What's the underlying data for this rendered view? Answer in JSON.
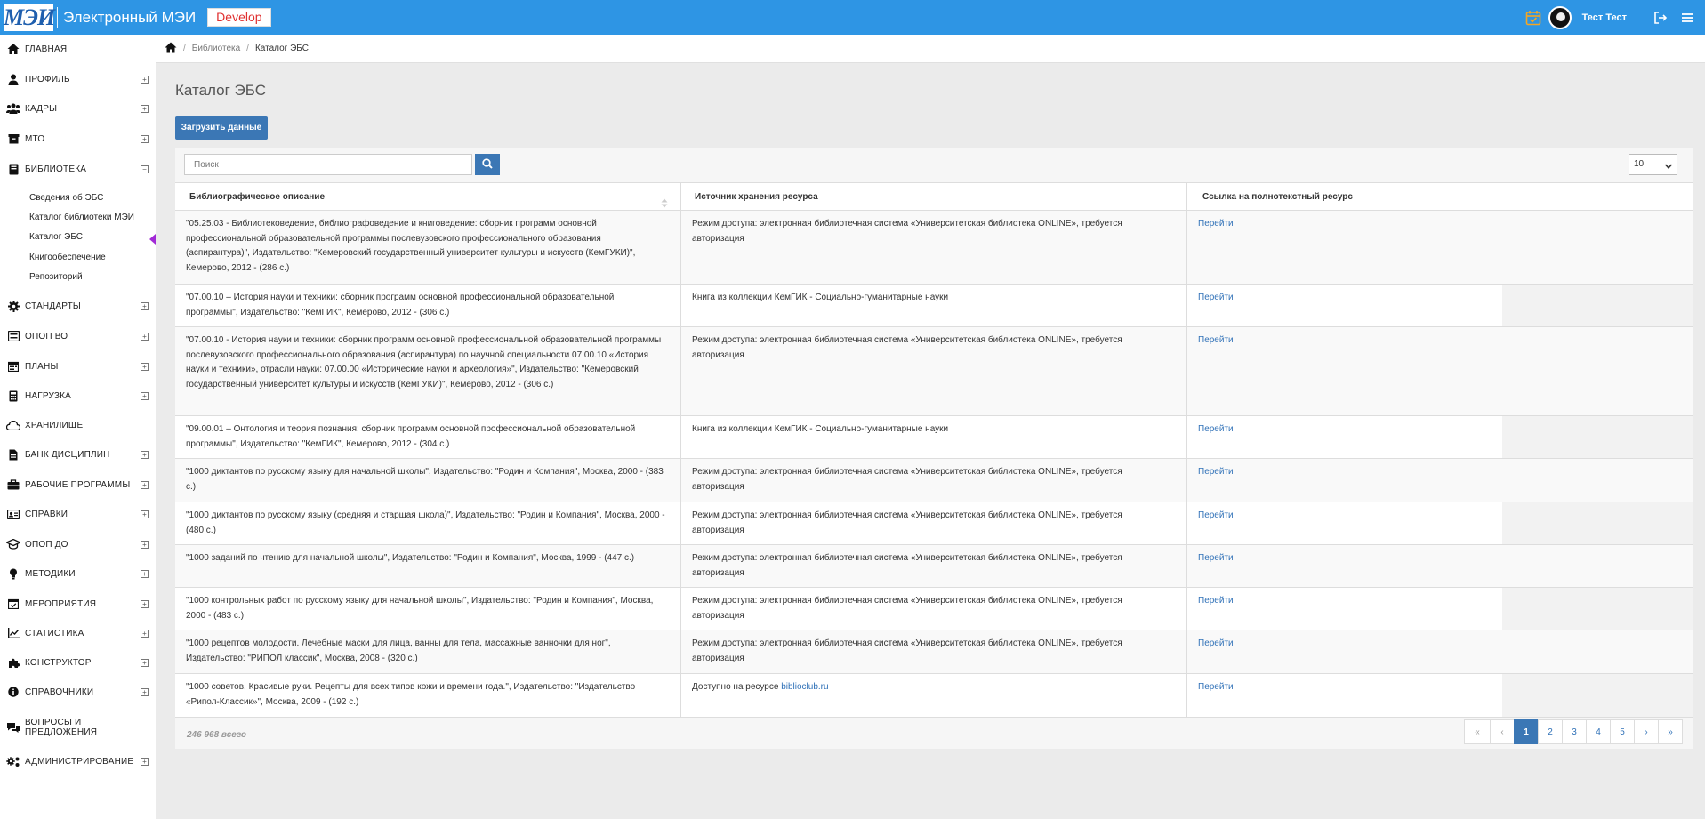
{
  "header": {
    "logo_text": "МЭИ",
    "app_title": "Электронный МЭИ",
    "env_badge": "Develop",
    "user_name": "Тест Тест",
    "icons": [
      "calendar-check-icon",
      "avatar",
      "logout-icon",
      "menu-icon"
    ]
  },
  "sidebar": {
    "items": [
      {
        "label": "ГЛАВНАЯ",
        "icon": "home-icon",
        "toggle": ""
      },
      {
        "label": "ПРОФИЛЬ",
        "icon": "user-icon",
        "toggle": "+"
      },
      {
        "label": "КАДРЫ",
        "icon": "users-icon",
        "toggle": "+"
      },
      {
        "label": "МТО",
        "icon": "box-icon",
        "toggle": "+"
      },
      {
        "label": "БИБЛИОТЕКА",
        "icon": "book-icon",
        "toggle": "−"
      },
      {
        "label": "СТАНДАРТЫ",
        "icon": "cog-icon",
        "toggle": "+"
      },
      {
        "label": "ОПОП ВО",
        "icon": "list-icon",
        "toggle": "+"
      },
      {
        "label": "ПЛАНЫ",
        "icon": "calendar-icon",
        "toggle": "+"
      },
      {
        "label": "НАГРУЗКА",
        "icon": "calculator-icon",
        "toggle": "+"
      },
      {
        "label": "ХРАНИЛИЩЕ",
        "icon": "cloud-icon",
        "toggle": ""
      },
      {
        "label": "БАНК ДИСЦИПЛИН",
        "icon": "file-icon",
        "toggle": "+"
      },
      {
        "label": "РАБОЧИЕ ПРОГРАММЫ",
        "icon": "briefcase-icon",
        "toggle": "+"
      },
      {
        "label": "СПРАВКИ",
        "icon": "id-card-icon",
        "toggle": "+"
      },
      {
        "label": "ОПОП ДО",
        "icon": "graduation-cap-icon",
        "toggle": "+"
      },
      {
        "label": "МЕТОДИКИ",
        "icon": "lightbulb-icon",
        "toggle": "+"
      },
      {
        "label": "МЕРОПРИЯТИЯ",
        "icon": "calendar-check-icon",
        "toggle": "+"
      },
      {
        "label": "СТАТИСТИКА",
        "icon": "chart-icon",
        "toggle": "+"
      },
      {
        "label": "КОНСТРУКТОР",
        "icon": "puzzle-icon",
        "toggle": "+"
      },
      {
        "label": "СПРАВОЧНИКИ",
        "icon": "info-icon",
        "toggle": "+"
      },
      {
        "label": "ВОПРОСЫ И ПРЕДЛОЖЕНИЯ",
        "icon": "comments-icon",
        "toggle": ""
      },
      {
        "label": "АДМИНИСТРИРОВАНИЕ",
        "icon": "cogs-icon",
        "toggle": "+"
      }
    ],
    "library_sub": [
      "Сведения об ЭБС",
      "Каталог библиотеки МЭИ",
      "Каталог ЭБС",
      "Книгообеспечение",
      "Репозиторий"
    ]
  },
  "breadcrumb": {
    "items": [
      "Библиотека",
      "Каталог ЭБС"
    ]
  },
  "main": {
    "title": "Каталог ЭБС",
    "load_button": "Загрузить данные",
    "search_placeholder": "Поиск",
    "page_size": "10",
    "columns": [
      "Библиографическое описание",
      "Источник хранения ресурса",
      "Ссылка на полнотекстный ресурс"
    ],
    "rows": [
      {
        "desc": "\"05.25.03 - Библиотековедение, библиографоведение и книговедение: сборник программ основной профессиональной образовательной программы послевузовского профессионального образования (аспирантура)\", Издательство: \"Кемеровский государственный университет культуры и искусств (КемГУКИ)\", Кемерово, 2012 - (286 с.)",
        "source": "Режим доступа: электронная библиотечная система «Университетская библиотека ONLINE», требуется авторизация",
        "source_link": "",
        "link": "Перейти"
      },
      {
        "desc": "\"07.00.10 – История науки и техники: сборник программ основной профессиональной образовательной программы\", Издательство: \"КемГИК\", Кемерово, 2012 - (306 с.)",
        "source": "Книга из коллекции КемГИК - Социально-гуманитарные науки",
        "source_link": "",
        "link": "Перейти"
      },
      {
        "desc": "\"07.00.10 - История науки и техники: сборник программ основной профессиональной образовательной программы послевузовского профессионального образования (аспирантура) по научной специальности 07.00.10 «История науки и техники», отрасли науки: 07.00.00 «Исторические науки и археология»\", Издательство: \"Кемеровский государственный университет культуры и искусств (КемГУКИ)\", Кемерово, 2012 - (306 с.)",
        "source": "Режим доступа: электронная библиотечная система «Университетская библиотека ONLINE», требуется авторизация",
        "source_link": "",
        "link": "Перейти"
      },
      {
        "desc": "\"09.00.01 – Онтология и теория познания: сборник программ основной профессиональной образовательной программы\", Издательство: \"КемГИК\", Кемерово, 2012 - (304 с.)",
        "source": "Книга из коллекции КемГИК - Социально-гуманитарные науки",
        "source_link": "",
        "link": "Перейти"
      },
      {
        "desc": "\"1000 диктантов по русскому языку для начальной школы\", Издательство: \"Родин и Компания\", Москва, 2000 - (383 с.)",
        "source": "Режим доступа: электронная библиотечная система «Университетская библиотека ONLINE», требуется авторизация",
        "source_link": "",
        "link": "Перейти"
      },
      {
        "desc": "\"1000 диктантов по русскому языку (средняя и старшая школа)\", Издательство: \"Родин и Компания\", Москва, 2000 - (480 с.)",
        "source": "Режим доступа: электронная библиотечная система «Университетская библиотека ONLINE», требуется авторизация",
        "source_link": "",
        "link": "Перейти"
      },
      {
        "desc": "\"1000 заданий по чтению для начальной школы\", Издательство: \"Родин и Компания\", Москва, 1999 - (447 с.)",
        "source": "Режим доступа: электронная библиотечная система «Университетская библиотека ONLINE», требуется авторизация",
        "source_link": "",
        "link": "Перейти"
      },
      {
        "desc": "\"1000 контрольных работ по русскому языку для начальной школы\", Издательство: \"Родин и Компания\", Москва, 2000 - (483 с.)",
        "source": "Режим доступа: электронная библиотечная система «Университетская библиотека ONLINE», требуется авторизация",
        "source_link": "",
        "link": "Перейти"
      },
      {
        "desc": "\"1000 рецептов молодости. Лечебные маски для лица, ванны для тела, массажные ванночки для ног\", Издательство: \"РИПОЛ классик\", Москва, 2008 - (320 с.)",
        "source": "Режим доступа: электронная библиотечная система «Университетская библиотека ONLINE», требуется авторизация",
        "source_link": "",
        "link": "Перейти"
      },
      {
        "desc": "\"1000 советов. Красивые руки. Рецепты для всех типов кожи и времени года.\", Издательство: \"Издательство «Рипол-Классик»\", Москва, 2009 - (192 с.)",
        "source": "Доступно на ресурсе ",
        "source_link": "biblioclub.ru",
        "link": "Перейти"
      }
    ],
    "total": "246 968 всего",
    "pager": {
      "first": "«",
      "prev": "‹",
      "pages": [
        "1",
        "2",
        "3",
        "4",
        "5"
      ],
      "active": "1",
      "next": "›",
      "last": "»"
    }
  },
  "colors": {
    "topbar": "#2e95e4",
    "primary_button": "#3b77b5",
    "link": "#3172b8",
    "active_marker": "#a12ad6"
  }
}
